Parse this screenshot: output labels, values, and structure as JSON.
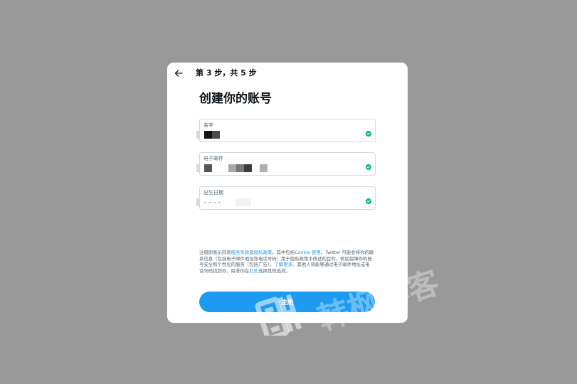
{
  "header": {
    "step_label": "第 3 步，共 5 步"
  },
  "title": "创建你的账号",
  "fields": [
    {
      "label": "名字",
      "value_masked": true
    },
    {
      "label": "电子邮件",
      "value_masked": true
    },
    {
      "label": "出生日期",
      "value": "- - - -"
    }
  ],
  "terms": {
    "p1": "注册即表示同意",
    "link_terms": "服务条款",
    "p2": "及",
    "link_privacy": "隐私政策",
    "p3": "，其中包括",
    "link_cookie": "Cookie 使用",
    "p4": "。Twitter 可能会将你的联系信息（包括电子邮件地址和电话号码）用于隐私政策中所述的目的，例如保障你的账号安全和个性化的服务（包括广告）。",
    "link_learn": "了解更多",
    "p5": "。其他人将能够通过电子邮件地址或电话号码找到你，除非你在",
    "link_here": "此处",
    "p6": "选择其他选项。"
  },
  "signup_label": "注册",
  "watermark_text": "韩枫博客",
  "colors": {
    "accent": "#1d9bf0",
    "success": "#00ba7c",
    "overlay": "#999999"
  }
}
